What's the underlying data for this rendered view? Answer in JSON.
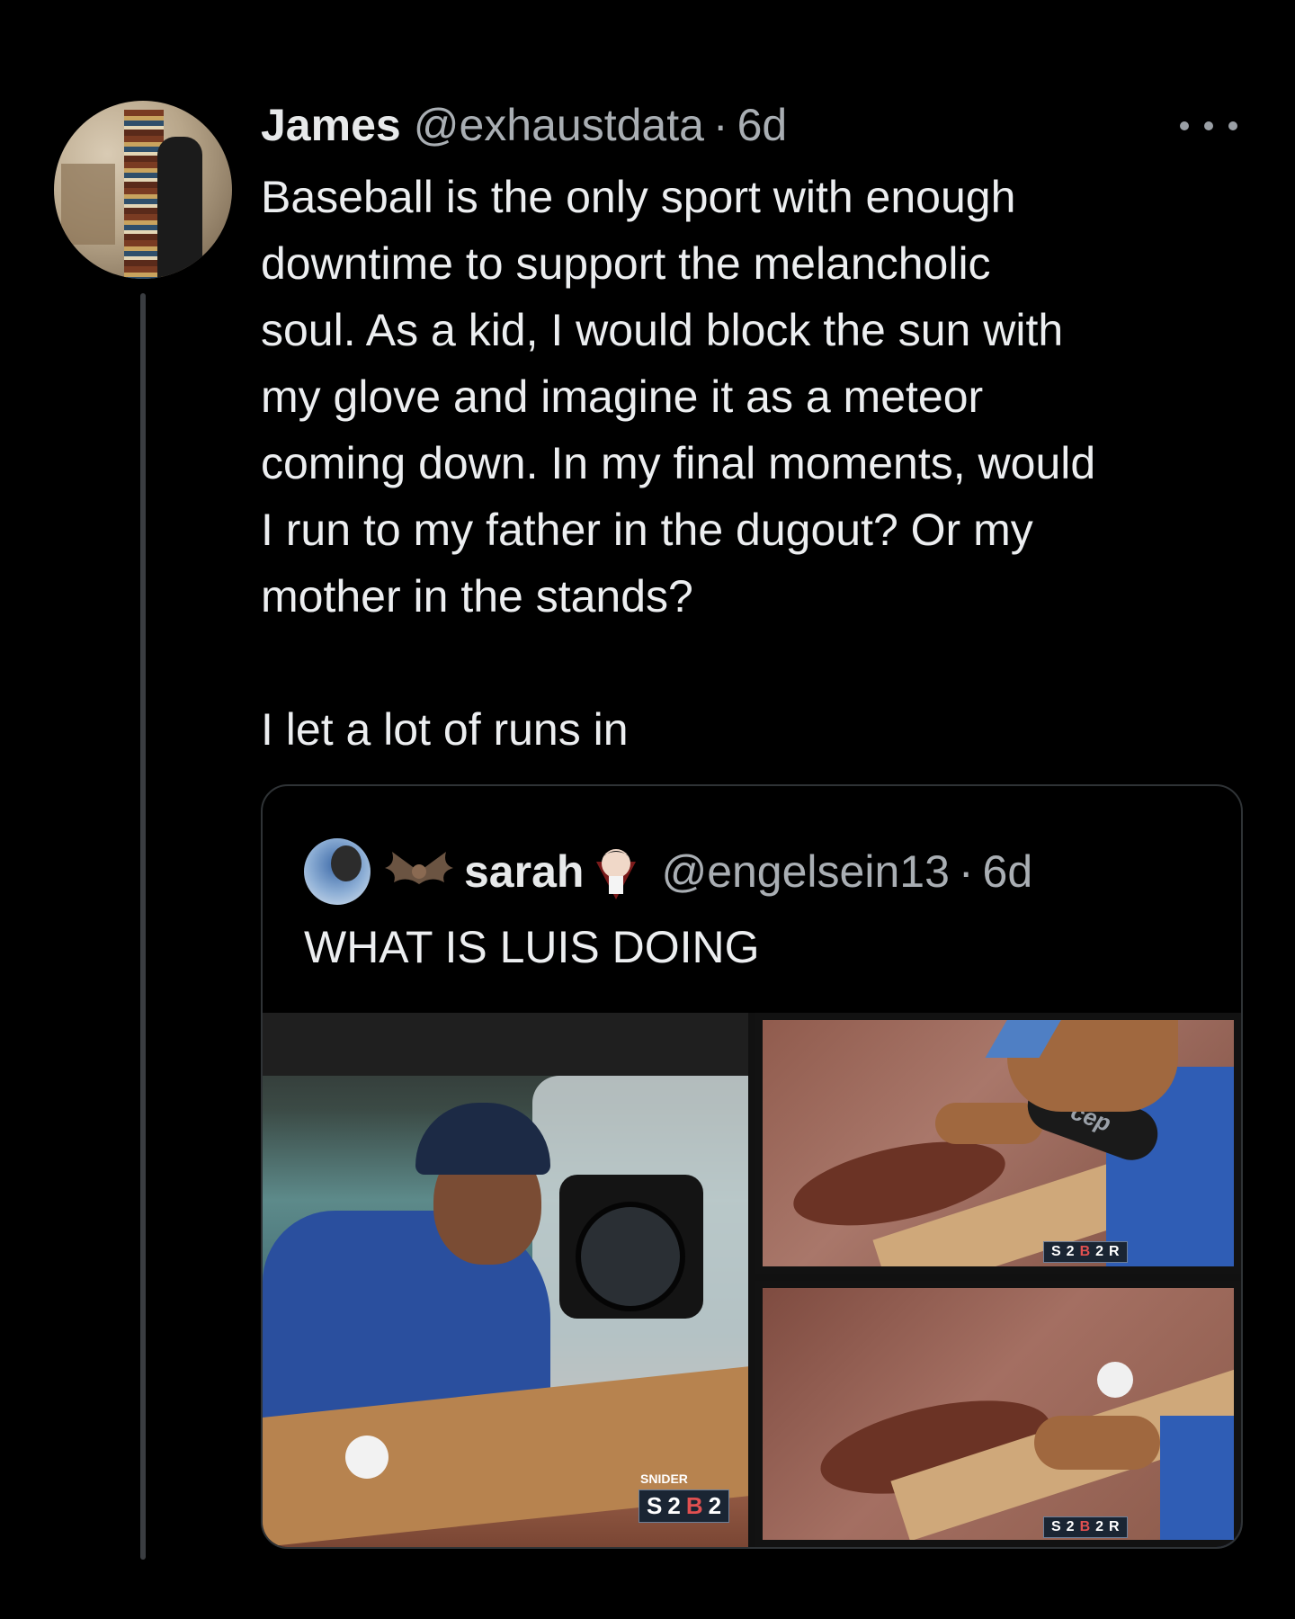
{
  "tweet": {
    "author_name": "James",
    "author_handle": "@exhaustdata",
    "separator": "·",
    "time": "6d",
    "text": "Baseball is the only sport with enough\ndowntime to support the melancholic\nsoul. As a kid, I would block the sun with\nmy glove and imagine it as a meteor\ncoming down. In my final moments, would\nI run to my father in the dugout? Or my\nmother in the stands?\n\nI let a lot of runs in"
  },
  "quote": {
    "author_name": "sarah",
    "author_handle": "@engelsein13",
    "separator": "·",
    "time": "6d",
    "text": "WHAT IS LUIS DOING",
    "media": {
      "image1_score": {
        "label": "SNIDER",
        "team_a": "S",
        "score_a": "2",
        "team_b": "B",
        "score_b": "2"
      },
      "image2_score": {
        "team_a": "S",
        "score_a": "2",
        "team_b": "B",
        "score_b": "2",
        "suffix": "R"
      },
      "image3_score": {
        "team_a": "S",
        "score_a": "2",
        "team_b": "B",
        "score_b": "2",
        "suffix": "R"
      },
      "sleeve_text": "cep"
    }
  },
  "icons": [
    "more-options-icon",
    "bat-emoji-icon",
    "vampire-emoji-icon"
  ],
  "colors": {
    "background": "#000000",
    "text": "#e7e9ea",
    "secondary_text": "#a9aeb3",
    "border": "#2f3336"
  }
}
